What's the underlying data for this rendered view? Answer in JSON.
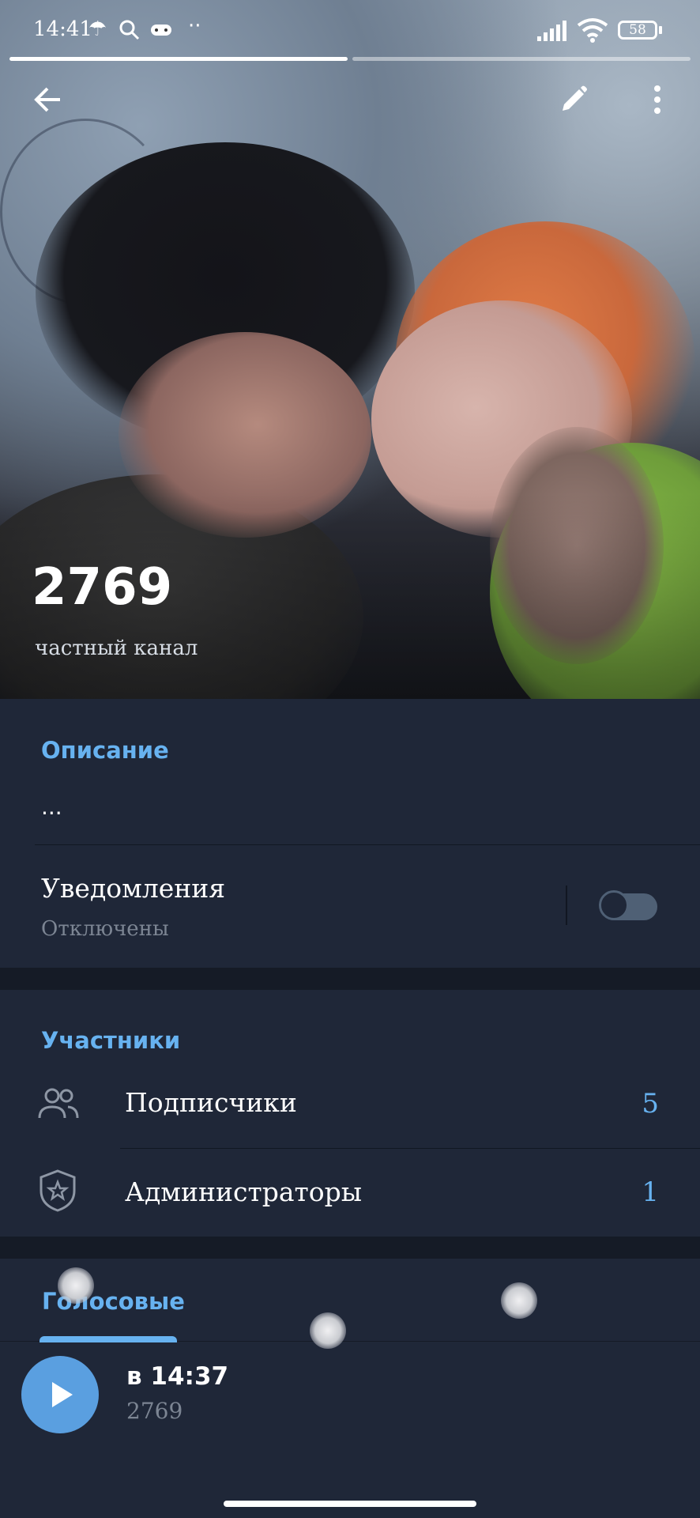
{
  "status_bar": {
    "time": "14:41",
    "battery": "58"
  },
  "header": {
    "back_icon": "arrow-left-icon",
    "edit_icon": "pencil-icon",
    "more_icon": "more-vertical-icon",
    "channel_name": "2769",
    "channel_type": "частный канал"
  },
  "description": {
    "title": "Описание",
    "text": "..."
  },
  "notifications": {
    "label": "Уведомления",
    "status": "Отключены",
    "enabled": false
  },
  "participants": {
    "title": "Участники",
    "items": [
      {
        "label": "Подписчики",
        "count": "5",
        "icon": "people-icon"
      },
      {
        "label": "Администраторы",
        "count": "1",
        "icon": "shield-star-icon"
      }
    ]
  },
  "tabs": {
    "voice_label": "Голосовые"
  },
  "voice_message": {
    "time": "в 14:37",
    "author": "2769"
  },
  "colors": {
    "accent": "#67b2f0",
    "background": "#1f2738",
    "play_button": "#5a9fe0"
  }
}
